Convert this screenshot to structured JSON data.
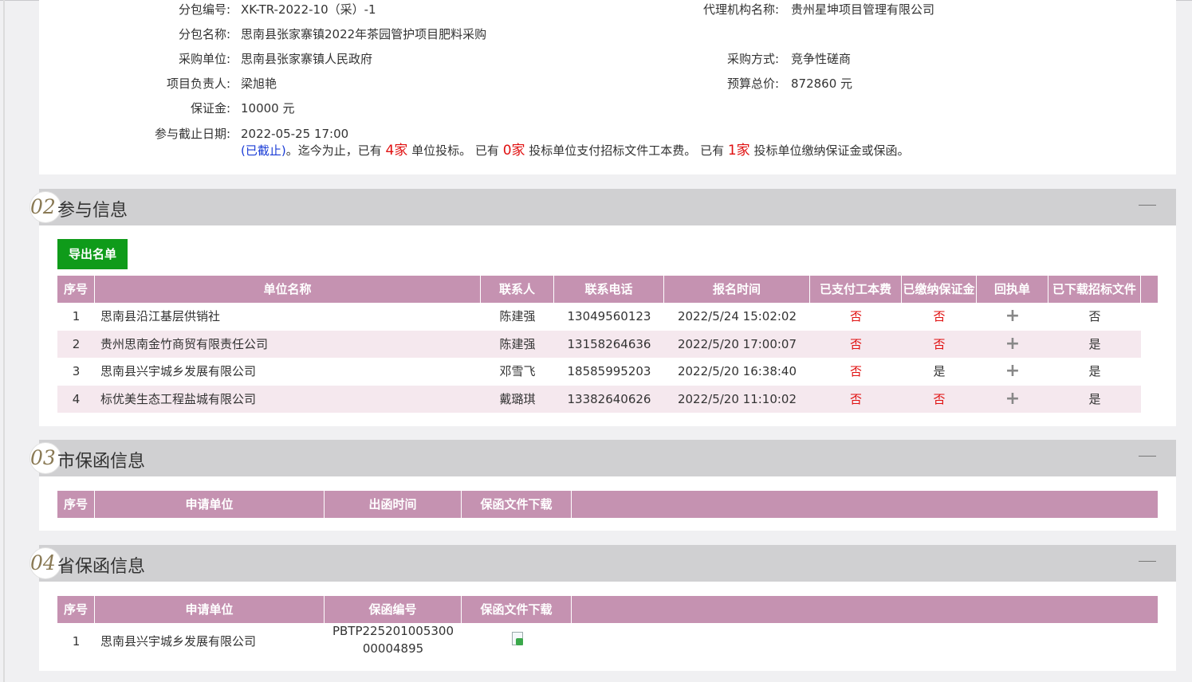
{
  "info": {
    "package_no_label": "分包编号:",
    "package_no": "XK-TR-2022-10（采）-1",
    "agency_label": "代理机构名称:",
    "agency": "贵州星坤项目管理有限公司",
    "package_name_label": "分包名称:",
    "package_name": "思南县张家寨镇2022年茶园管护项目肥料采购",
    "buyer_label": "采购单位:",
    "buyer": "思南县张家寨镇人民政府",
    "method_label": "采购方式:",
    "method": "竞争性磋商",
    "manager_label": "项目负责人:",
    "manager": "梁旭艳",
    "budget_label": "预算总价:",
    "budget": "872860 元",
    "deposit_label": "保证金:",
    "deposit": "10000 元",
    "deadline_label": "参与截止日期:",
    "deadline": "2022-05-25 17:00",
    "status": "(已截止)",
    "summary_1": "。迄今为止，已有",
    "bid_count": "4家",
    "summary_2": "单位投标。 已有",
    "paid_count": "0家",
    "summary_3": "投标单位支付招标文件工本费。 已有",
    "deposit_count": "1家",
    "summary_4": "投标单位缴纳保证金或保函。"
  },
  "sections": {
    "s2": {
      "num": "02",
      "title": "参与信息"
    },
    "s3": {
      "num": "03",
      "title": "市保函信息"
    },
    "s4": {
      "num": "04",
      "title": "省保函信息"
    }
  },
  "export_label": "导出名单",
  "participants": {
    "headers": [
      "序号",
      "单位名称",
      "联系人",
      "联系电话",
      "报名时间",
      "已支付工本费",
      "已缴纳保证金",
      "回执单",
      "已下载招标文件"
    ],
    "rows": [
      [
        "1",
        "思南县沿江基层供销社",
        "陈建强",
        "13049560123",
        "2022/5/24 15:02:02",
        "否",
        "否",
        "+",
        "否"
      ],
      [
        "2",
        "贵州思南金竹商贸有限责任公司",
        "陈建强",
        "13158264636",
        "2022/5/20 17:00:07",
        "否",
        "否",
        "+",
        "是"
      ],
      [
        "3",
        "思南县兴宇城乡发展有限公司",
        "邓雪飞",
        "18585995203",
        "2022/5/20 16:38:40",
        "否",
        "是",
        "+",
        "是"
      ],
      [
        "4",
        "标优美生态工程盐城有限公司",
        "戴璐琪",
        "13382640626",
        "2022/5/20 11:10:02",
        "否",
        "否",
        "+",
        "是"
      ]
    ]
  },
  "city_guarantee": {
    "headers": [
      "序号",
      "申请单位",
      "出函时间",
      "保函文件下载"
    ]
  },
  "province_guarantee": {
    "headers": [
      "序号",
      "申请单位",
      "保函编号",
      "保函文件下载"
    ],
    "rows": [
      [
        "1",
        "思南县兴宇城乡发展有限公司",
        "PBTP225201005300",
        "00004895",
        "download-file-icon"
      ]
    ]
  },
  "colors": {
    "header_bg": "#c592b1",
    "alt_row": "#f5e8ee",
    "button_green": "#0f9b1a",
    "negative_red": "#e01010"
  }
}
